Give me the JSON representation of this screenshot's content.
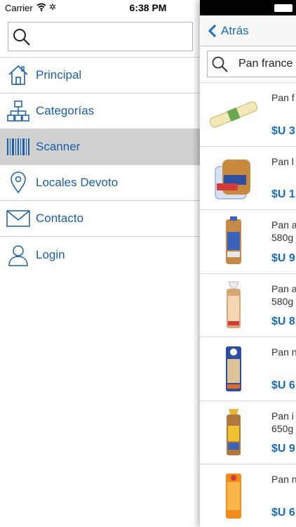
{
  "status": {
    "carrier": "Carrier",
    "time": "6:38 PM",
    "loading": "✲"
  },
  "menu": {
    "search_placeholder": "",
    "items": [
      {
        "label": "Principal",
        "icon": "home-icon"
      },
      {
        "label": "Categorías",
        "icon": "sitemap-icon"
      },
      {
        "label": "Scanner",
        "icon": "barcode-icon",
        "selected": true
      },
      {
        "label": "Locales Devoto",
        "icon": "location-pin-icon"
      },
      {
        "label": "Contacto",
        "icon": "envelope-icon"
      },
      {
        "label": "Login",
        "icon": "user-icon"
      }
    ]
  },
  "panel": {
    "back_label": "Atrás",
    "search_value": "Pan france",
    "products": [
      {
        "name": "Pan f",
        "subtitle": "",
        "price": "$U 3"
      },
      {
        "name": "Pan l",
        "subtitle": "",
        "price": "$U 1"
      },
      {
        "name": "Pan a",
        "subtitle": "580g",
        "price": "$U 9"
      },
      {
        "name": "Pan a",
        "subtitle": "580g",
        "price": "$U 8"
      },
      {
        "name": "Pan n",
        "subtitle": "",
        "price": "$U 6"
      },
      {
        "name": "Pan i",
        "subtitle": "650g",
        "price": "$U 9"
      },
      {
        "name": "Pan n",
        "subtitle": "",
        "price": "$U 6"
      }
    ]
  },
  "colors": {
    "accent": "#1a5fa8",
    "selected_bg": "#d0d0d0",
    "price": "#1a6bc2"
  }
}
